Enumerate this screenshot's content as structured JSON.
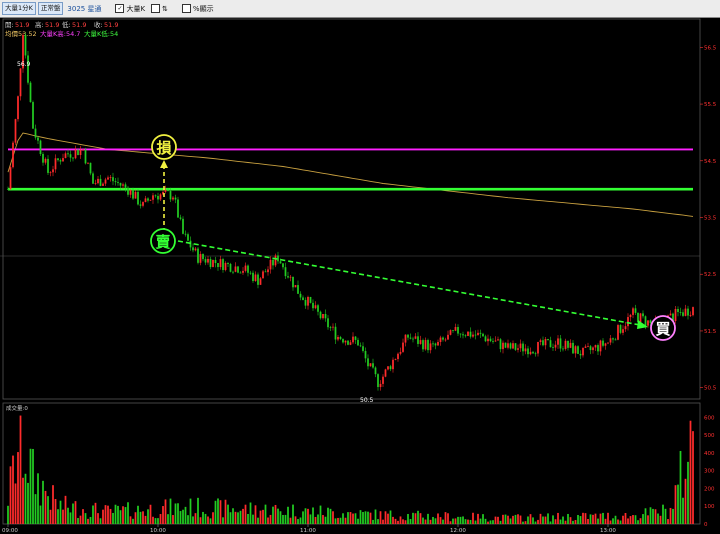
{
  "toolbar": {
    "period_button": "大量1分K",
    "market_button": "正常盤",
    "symbol": "3025 星通",
    "option_large_k": "大量K",
    "option_percent": "%顯示",
    "large_k_checked": true,
    "percent_checked": false
  },
  "quote": {
    "open_label": "開:",
    "open": "51.9",
    "high_label": "高:",
    "high": "51.9",
    "low_label": "低:",
    "low": "51.9",
    "close_label": "收:",
    "close": "51.9",
    "avg_label": "均價53.52",
    "large_k_high": "大量K高:54.7",
    "large_k_low": "大量K低:54"
  },
  "annotations": {
    "peak_label": "56.9",
    "bottom_label": "50.5",
    "stop_loss": "損",
    "sell": "賣",
    "buy": "買"
  },
  "volume_panel_label": "成交量:0",
  "colors": {
    "up": "#ff2b2b",
    "down": "#22cc22",
    "avg_line": "#c8a040",
    "magenta_line": "#ff20ff",
    "green_line": "#33ff33",
    "axis": "#ff3030",
    "vol_axis": "#ff3030"
  },
  "chart_data": {
    "type": "candlestick",
    "price_axis_ticks": [
      "56.5",
      "55.5",
      "54.5",
      "53.5",
      "52.5",
      "51.5",
      "50.5"
    ],
    "volume_axis_ticks": [
      "600",
      "500",
      "400",
      "300",
      "200",
      "100",
      "0"
    ],
    "time_axis_ticks": [
      "09:00",
      "10:00",
      "11:00",
      "12:00",
      "13:00"
    ],
    "ylim": [
      50.3,
      57.0
    ],
    "volume_ylim": [
      0,
      630
    ],
    "reference_lines": {
      "magenta": 54.7,
      "green": 54.0
    },
    "average_line_anchors": [
      [
        0,
        54.3
      ],
      [
        5,
        55.0
      ],
      [
        15,
        54.9
      ],
      [
        40,
        54.7
      ],
      [
        80,
        54.55
      ],
      [
        110,
        54.4
      ],
      [
        150,
        54.1
      ],
      [
        200,
        53.85
      ],
      [
        250,
        53.65
      ],
      [
        274,
        53.52
      ]
    ],
    "price_path_anchors": [
      [
        0,
        54.0
      ],
      [
        4,
        55.6
      ],
      [
        6,
        56.8
      ],
      [
        10,
        55.1
      ],
      [
        16,
        54.3
      ],
      [
        22,
        54.6
      ],
      [
        30,
        54.7
      ],
      [
        34,
        54.1
      ],
      [
        40,
        54.2
      ],
      [
        48,
        54.0
      ],
      [
        54,
        53.7
      ],
      [
        58,
        53.9
      ],
      [
        66,
        53.9
      ],
      [
        70,
        53.2
      ],
      [
        76,
        52.8
      ],
      [
        84,
        52.7
      ],
      [
        94,
        52.6
      ],
      [
        100,
        52.4
      ],
      [
        108,
        52.8
      ],
      [
        116,
        52.2
      ],
      [
        124,
        51.8
      ],
      [
        132,
        51.4
      ],
      [
        140,
        51.3
      ],
      [
        144,
        50.9
      ],
      [
        148,
        50.6
      ],
      [
        150,
        50.7
      ],
      [
        160,
        51.4
      ],
      [
        170,
        51.2
      ],
      [
        180,
        51.5
      ],
      [
        190,
        51.4
      ],
      [
        200,
        51.2
      ],
      [
        210,
        51.2
      ],
      [
        220,
        51.3
      ],
      [
        230,
        51.1
      ],
      [
        240,
        51.3
      ],
      [
        250,
        51.8
      ],
      [
        258,
        51.6
      ],
      [
        268,
        51.8
      ],
      [
        274,
        51.9
      ]
    ],
    "volume_profile": [
      [
        0,
        180
      ],
      [
        5,
        560
      ],
      [
        10,
        320
      ],
      [
        20,
        120
      ],
      [
        40,
        80
      ],
      [
        70,
        110
      ],
      [
        110,
        90
      ],
      [
        150,
        60
      ],
      [
        200,
        40
      ],
      [
        250,
        55
      ],
      [
        265,
        90
      ],
      [
        274,
        560
      ]
    ]
  }
}
